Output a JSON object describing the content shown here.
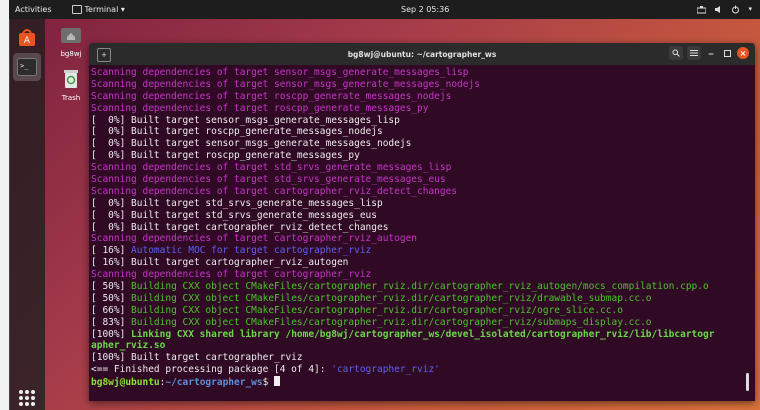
{
  "topbar": {
    "activities": "Activities",
    "app_name": "Terminal ▾",
    "clock": "Sep 2  05:36"
  },
  "desktop": {
    "home_label": "bg8wj",
    "trash_label": "Trash"
  },
  "window": {
    "title": "bg8wj@ubuntu: ~/cartographer_ws"
  },
  "terminal": {
    "lines": [
      {
        "style": "magenta",
        "text": "Scanning dependencies of target sensor_msgs_generate_messages_lisp"
      },
      {
        "style": "magenta",
        "text": "Scanning dependencies of target sensor_msgs_generate_messages_nodejs"
      },
      {
        "style": "magenta",
        "text": "Scanning dependencies of target roscpp_generate_messages_nodejs"
      },
      {
        "style": "magenta",
        "text": "Scanning dependencies of target roscpp_generate_messages_py"
      },
      {
        "style": "white",
        "text": "[  0%] Built target sensor_msgs_generate_messages_lisp"
      },
      {
        "style": "white",
        "text": "[  0%] Built target roscpp_generate_messages_nodejs"
      },
      {
        "style": "white",
        "text": "[  0%] Built target sensor_msgs_generate_messages_nodejs"
      },
      {
        "style": "white",
        "text": "[  0%] Built target roscpp_generate_messages_py"
      },
      {
        "style": "magenta",
        "text": "Scanning dependencies of target std_srvs_generate_messages_lisp"
      },
      {
        "style": "magenta",
        "text": "Scanning dependencies of target std_srvs_generate_messages_eus"
      },
      {
        "style": "magenta",
        "text": "Scanning dependencies of target cartographer_rviz_detect_changes"
      },
      {
        "style": "white",
        "text": "[  0%] Built target std_srvs_generate_messages_lisp"
      },
      {
        "style": "white",
        "text": "[  0%] Built target std_srvs_generate_messages_eus"
      },
      {
        "style": "white",
        "text": "[  0%] Built target cartographer_rviz_detect_changes"
      },
      {
        "style": "magenta",
        "text": "Scanning dependencies of target cartographer_rviz_autogen"
      },
      {
        "style": "mixed16",
        "prefix": "[ 16%] ",
        "text": "Automatic MOC for target cartographer_rviz"
      },
      {
        "style": "white",
        "text": "[ 16%] Built target cartographer_rviz_autogen"
      },
      {
        "style": "magenta",
        "text": "Scanning dependencies of target cartographer_rviz"
      },
      {
        "style": "mixedgreen",
        "prefix": "[ 50%] ",
        "text": "Building CXX object CMakeFiles/cartographer_rviz.dir/cartographer_rviz_autogen/mocs_compilation.cpp.o"
      },
      {
        "style": "mixedgreen",
        "prefix": "[ 50%] ",
        "text": "Building CXX object CMakeFiles/cartographer_rviz.dir/cartographer_rviz/drawable_submap.cc.o"
      },
      {
        "style": "mixedgreen",
        "prefix": "[ 66%] ",
        "text": "Building CXX object CMakeFiles/cartographer_rviz.dir/cartographer_rviz/ogre_slice.cc.o"
      },
      {
        "style": "mixedgreen",
        "prefix": "[ 83%] ",
        "text": "Building CXX object CMakeFiles/cartographer_rviz.dir/cartographer_rviz/submaps_display.cc.o"
      },
      {
        "style": "mixedbold",
        "prefix": "[100%] ",
        "text": "Linking CXX shared library /home/bg8wj/cartographer_ws/devel_isolated/cartographer_rviz/lib/libcartogr"
      },
      {
        "style": "boldgreen",
        "text": "apher_rviz.so"
      },
      {
        "style": "white",
        "text": "[100%] Built target cartographer_rviz"
      },
      {
        "style": "finished",
        "text": "<== Finished processing package [4 of 4]: ",
        "pkg": "'cartographer_rviz'"
      }
    ],
    "prompt": {
      "user": "bg8wj@ubuntu",
      "path": "~/cartographer_ws",
      "symbol": "$ "
    }
  }
}
